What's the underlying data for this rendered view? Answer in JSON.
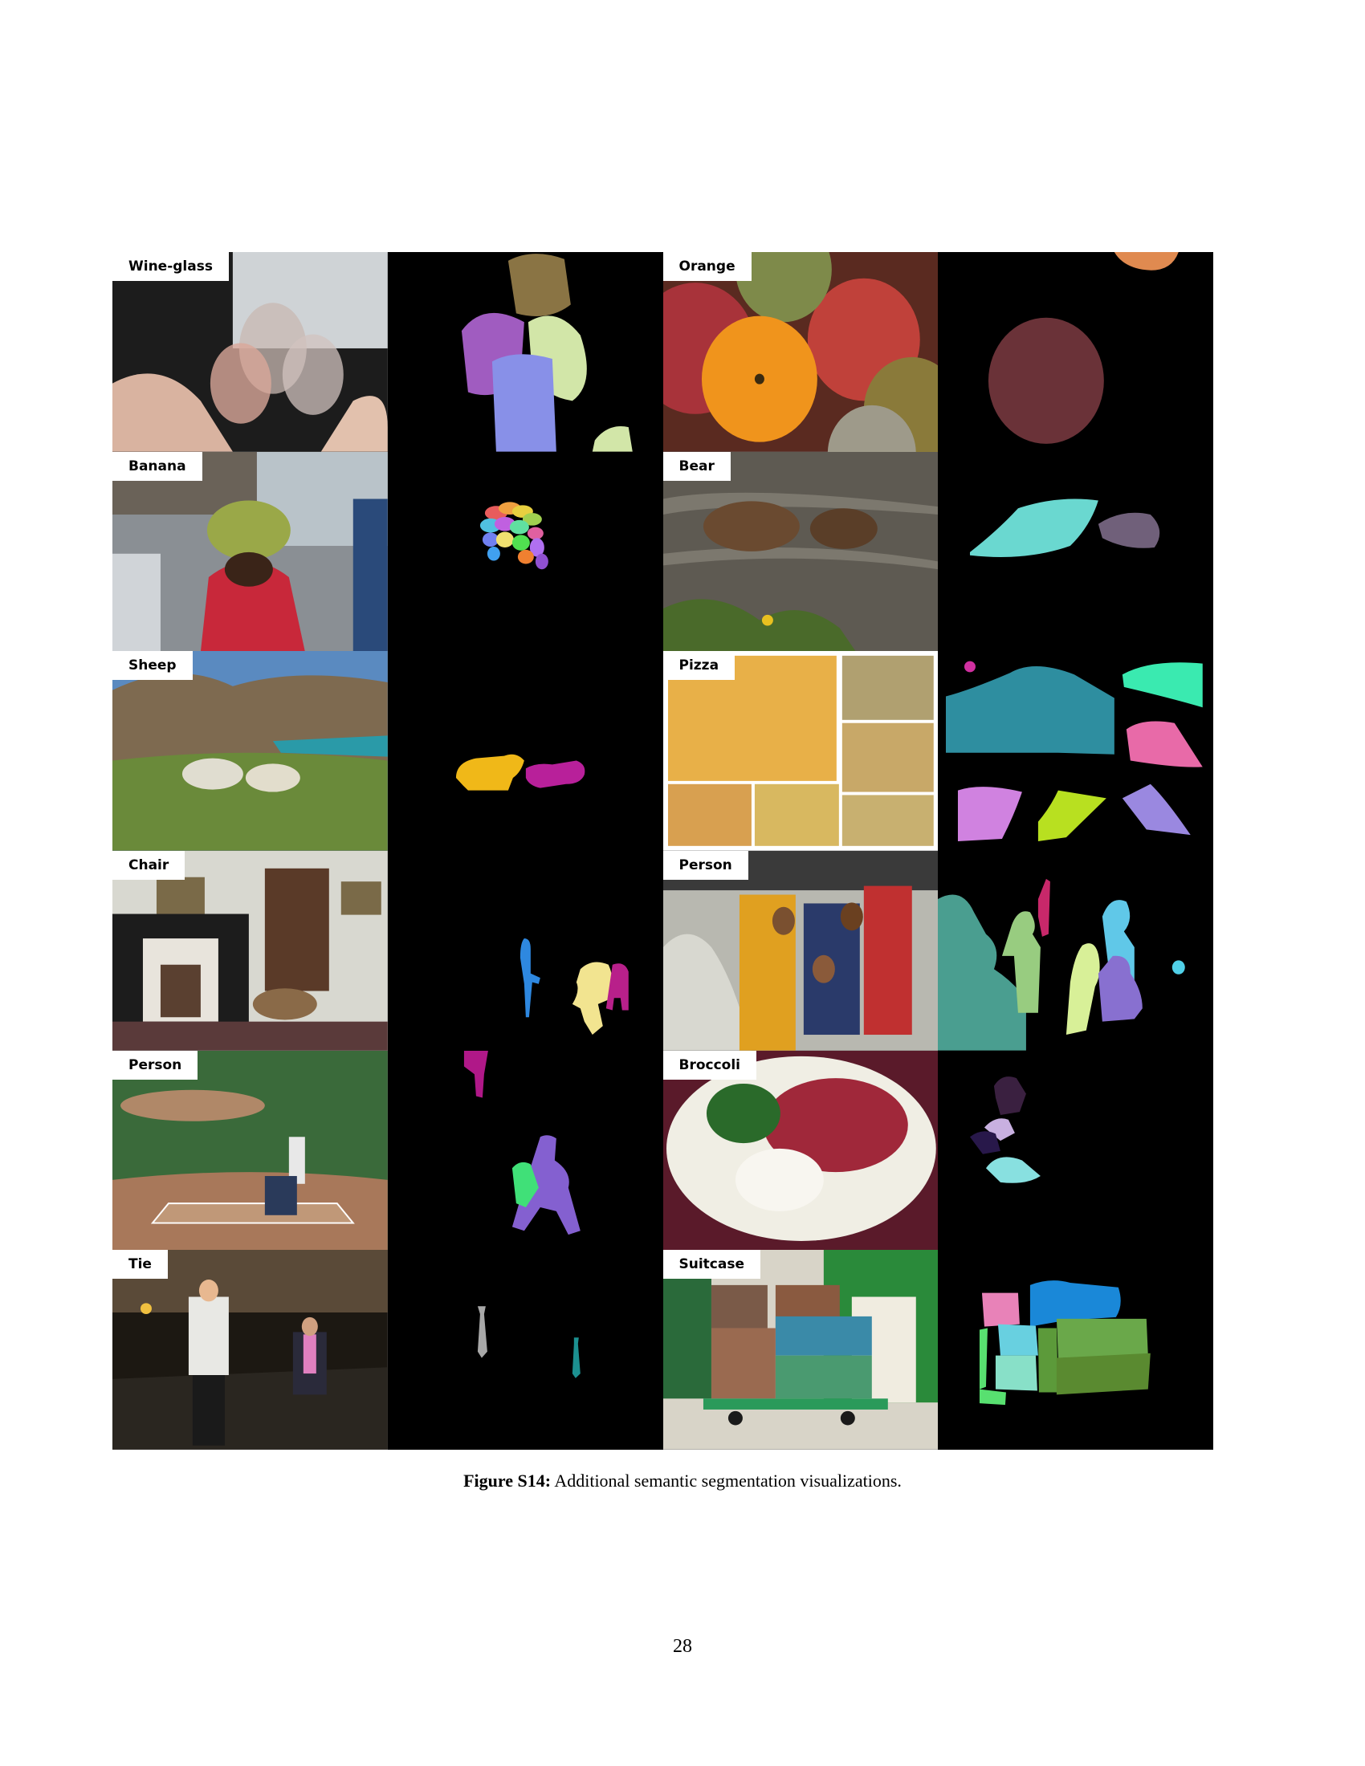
{
  "figure": {
    "labels": [
      "Wine-glass",
      "Orange",
      "Banana",
      "Bear",
      "Sheep",
      "Pizza",
      "Chair",
      "Person",
      "Person",
      "Broccoli",
      "Tie",
      "Suitcase"
    ],
    "caption_label": "Figure S14:",
    "caption_text": " Additional semantic segmentation visualizations."
  },
  "page_number": "28"
}
